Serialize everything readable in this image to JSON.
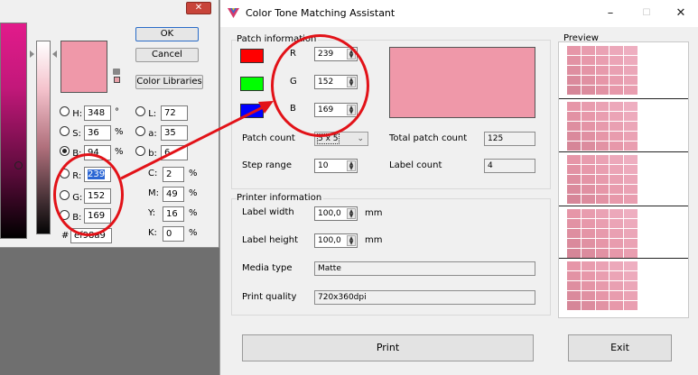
{
  "picker": {
    "close_glyph": "✕",
    "ok_label": "OK",
    "cancel_label": "Cancel",
    "libraries_label": "Color Libraries",
    "swatch_color": "#ef98a9",
    "fields": {
      "h": {
        "label": "H:",
        "value": "348",
        "unit": "°"
      },
      "s": {
        "label": "S:",
        "value": "36",
        "unit": "%"
      },
      "b": {
        "label": "B:",
        "value": "94",
        "unit": "%"
      },
      "r": {
        "label": "R:",
        "value": "239"
      },
      "g": {
        "label": "G:",
        "value": "152"
      },
      "bb": {
        "label": "B:",
        "value": "169"
      },
      "l": {
        "label": "L:",
        "value": "72"
      },
      "a": {
        "label": "a:",
        "value": "35"
      },
      "lab_b": {
        "label": "b:",
        "value": "6"
      },
      "c": {
        "label": "C:",
        "value": "2",
        "unit": "%"
      },
      "m": {
        "label": "M:",
        "value": "49",
        "unit": "%"
      },
      "y": {
        "label": "Y:",
        "value": "16",
        "unit": "%"
      },
      "k": {
        "label": "K:",
        "value": "0",
        "unit": "%"
      },
      "hex": {
        "label": "#",
        "value": "ef98a9"
      }
    }
  },
  "window": {
    "title": "Color Tone Matching Assistant",
    "minimize_glyph": "–",
    "maximize_glyph": "☐",
    "close_glyph": "✕",
    "patch": {
      "group_title": "Patch information",
      "r_label": "R",
      "r_value": "239",
      "r_chip": "#ff0000",
      "g_label": "G",
      "g_value": "152",
      "g_chip": "#00ff00",
      "b_label": "B",
      "b_value": "169",
      "b_chip": "#0000ff",
      "patch_color": "#ef98a9",
      "patch_count_label": "Patch count",
      "patch_count_value": "5 x 5",
      "total_patch_label": "Total patch count",
      "total_patch_value": "125",
      "step_range_label": "Step range",
      "step_range_value": "10",
      "label_count_label": "Label count",
      "label_count_value": "4"
    },
    "printer": {
      "group_title": "Printer information",
      "label_width_label": "Label width",
      "label_width_value": "100,0",
      "label_width_unit": "mm",
      "label_height_label": "Label height",
      "label_height_value": "100,0",
      "label_height_unit": "mm",
      "media_type_label": "Media type",
      "media_type_value": "Matte",
      "print_quality_label": "Print quality",
      "print_quality_value": "720x360dpi"
    },
    "preview_title": "Preview",
    "print_label": "Print",
    "exit_label": "Exit"
  },
  "annotation_color": "#e21218"
}
